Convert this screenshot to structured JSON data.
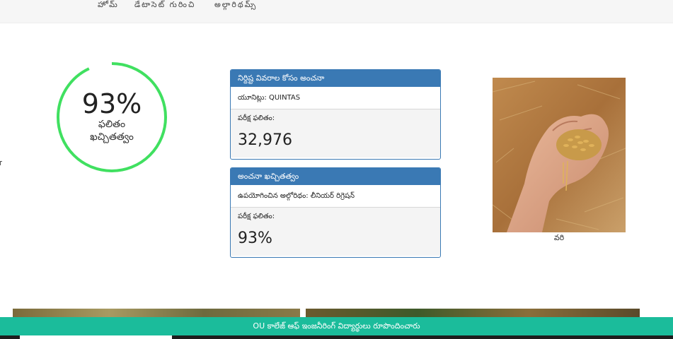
{
  "nav": {
    "items": [
      "హోమ్",
      "డేటాసెట్ గురించి",
      "అల్గారిథమ్స్"
    ]
  },
  "gauge": {
    "value": 93,
    "value_text": "93%",
    "label_line1": "ఫలితం",
    "label_line2": "ఖచ్చితత్వం",
    "color": "#40e060"
  },
  "panels": {
    "prediction": {
      "header": "నిర్దిష్ట వివరాల కోసం అంచనా",
      "unit_line": "యూనిట్లు: QUINTAS",
      "result_label": "పరీక్ష ఫలితం:",
      "result_value": "32,976"
    },
    "accuracy": {
      "header": "అంచనా ఖచ్చితత్వం",
      "algorithm_line": "ఉపయోగించిన అల్గోరిథం: లీనియర్ రిగ్రెషన్",
      "result_label": "పరీక్ష ఫలితం:",
      "result_value": "93%"
    }
  },
  "crop": {
    "caption": "వరి"
  },
  "footer": {
    "text": "OU కాలేజ్ ఆఫ్ ఇంజనీరింగ్ విద్యార్థులు రూపొందించారు"
  },
  "colors": {
    "panel_header": "#3a79b4",
    "footer": "#1bbc9b",
    "gauge_ring": "#40e060"
  }
}
